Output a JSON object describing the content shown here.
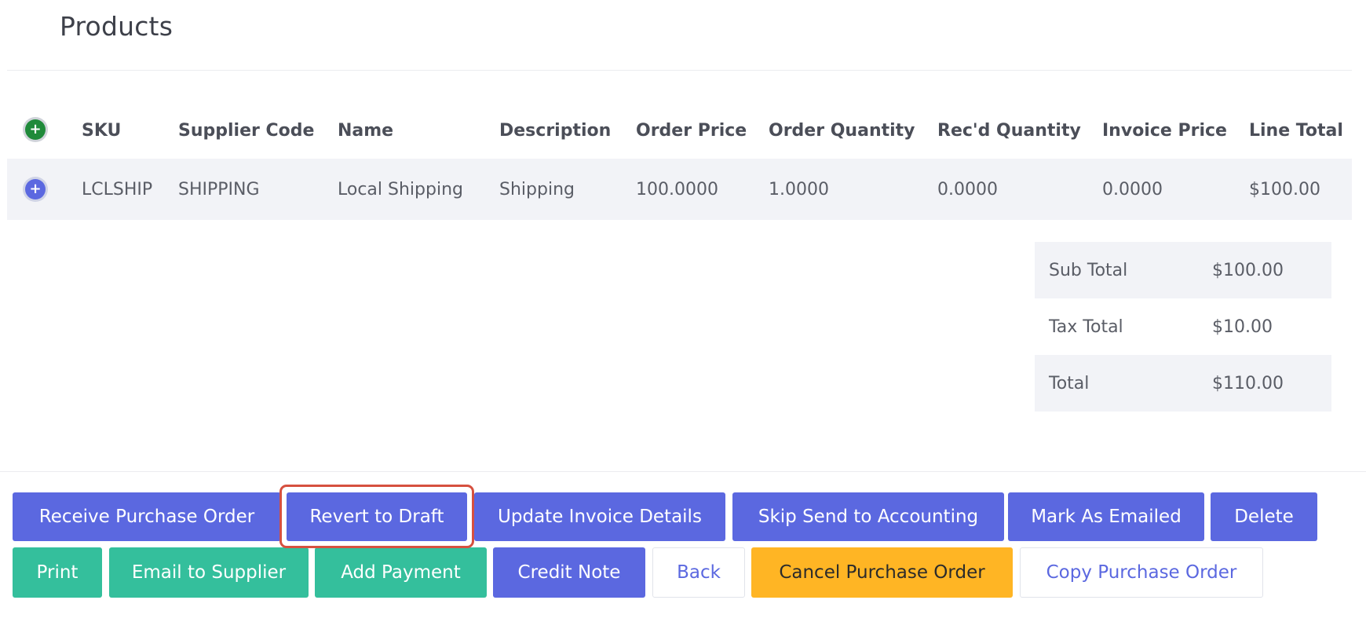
{
  "page": {
    "title": "Products"
  },
  "table": {
    "columns": [
      "SKU",
      "Supplier Code",
      "Name",
      "Description",
      "Order Price",
      "Order Quantity",
      "Rec'd Quantity",
      "Invoice Price",
      "Line Total"
    ],
    "rows": [
      {
        "sku": "LCLSHIP",
        "supplier_code": "SHIPPING",
        "name": "Local Shipping",
        "description": "Shipping",
        "order_price": "100.0000",
        "order_quantity": "1.0000",
        "recd_quantity": "0.0000",
        "invoice_price": "0.0000",
        "line_total": "$100.00"
      }
    ]
  },
  "totals": {
    "sub_total_label": "Sub Total",
    "sub_total": "$100.00",
    "tax_total_label": "Tax Total",
    "tax_total": "$10.00",
    "total_label": "Total",
    "total": "$110.00"
  },
  "actions": {
    "receive": "Receive Purchase Order",
    "revert": "Revert to Draft",
    "update_invoice": "Update Invoice Details",
    "skip_accounting": "Skip Send to Accounting",
    "mark_emailed": "Mark As Emailed",
    "delete": "Delete",
    "print": "Print",
    "email_supplier": "Email to Supplier",
    "add_payment": "Add Payment",
    "credit_note": "Credit Note",
    "back": "Back",
    "cancel_po": "Cancel Purchase Order",
    "copy_po": "Copy Purchase Order"
  },
  "icons": {
    "add_line": "plus-circle-icon",
    "expand_row": "plus-circle-icon"
  },
  "colors": {
    "primary": "#5b68e0",
    "success": "#34bf9c",
    "warning": "#ffb524",
    "highlight": "#d6503f"
  }
}
